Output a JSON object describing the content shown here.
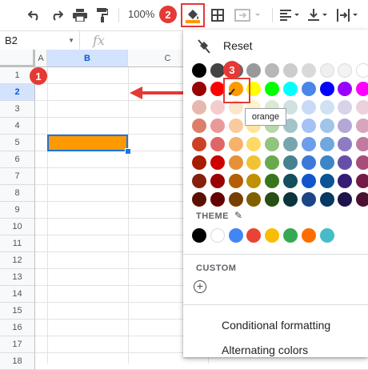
{
  "toolbar": {
    "zoom": "100%",
    "icons": [
      "undo-icon",
      "redo-icon",
      "print-icon",
      "paint-format-icon",
      "fill-color-icon",
      "borders-icon",
      "merge-cells-icon",
      "horizontal-align-icon",
      "vertical-align-icon",
      "text-rotation-icon"
    ]
  },
  "formula_bar": {
    "cell_ref": "B2",
    "fx": "fx"
  },
  "grid": {
    "columns": [
      "A",
      "B",
      "C"
    ],
    "rows": [
      "1",
      "2",
      "3",
      "4",
      "5",
      "6",
      "7",
      "8",
      "9",
      "10",
      "11",
      "12",
      "13",
      "14",
      "15",
      "16",
      "17",
      "18"
    ],
    "selected_cell": "B2",
    "fill_color": "#ff9900"
  },
  "callouts": {
    "step1": "1",
    "step2": "2",
    "step3": "3"
  },
  "color_menu": {
    "reset_label": "Reset",
    "tooltip": "orange",
    "theme_title": "THEME",
    "custom_title": "CUSTOM",
    "items": [
      {
        "label": "Conditional formatting"
      },
      {
        "label": "Alternating colors"
      }
    ],
    "standard_rows": [
      [
        "#000000",
        "#434343",
        "#666666",
        "#999999",
        "#b7b7b7",
        "#cccccc",
        "#d9d9d9",
        "#efefef",
        "#f3f3f3",
        "#ffffff"
      ],
      [
        "#980000",
        "#ff0000",
        "#ff9900",
        "#ffff00",
        "#00ff00",
        "#00ffff",
        "#4a86e8",
        "#0000ff",
        "#9900ff",
        "#ff00ff"
      ],
      [
        "#e6b8af",
        "#f4cccc",
        "#fce5cd",
        "#fff2cc",
        "#d9ead3",
        "#d0e0e3",
        "#c9daf8",
        "#cfe2f3",
        "#d9d2e9",
        "#ead1dc"
      ],
      [
        "#dd7e6b",
        "#ea9999",
        "#f9cb9c",
        "#ffe599",
        "#b6d7a8",
        "#a2c4c9",
        "#a4c2f4",
        "#9fc5e8",
        "#b4a7d6",
        "#d5a6bd"
      ],
      [
        "#cc4125",
        "#e06666",
        "#f6b26b",
        "#ffd966",
        "#93c47d",
        "#76a5af",
        "#6d9eeb",
        "#6fa8dc",
        "#8e7cc3",
        "#c27ba0"
      ],
      [
        "#a61c00",
        "#cc0000",
        "#e69138",
        "#f1c232",
        "#6aa84f",
        "#45818e",
        "#3c78d8",
        "#3d85c6",
        "#674ea7",
        "#a64d79"
      ],
      [
        "#85200c",
        "#990000",
        "#b45f06",
        "#bf9000",
        "#38761d",
        "#134f5c",
        "#1155cc",
        "#0b5394",
        "#351c75",
        "#741b47"
      ],
      [
        "#5b0f00",
        "#660000",
        "#783f04",
        "#7f6000",
        "#274e13",
        "#0c343d",
        "#1c4587",
        "#073763",
        "#20124d",
        "#4c1130"
      ]
    ],
    "theme_colors": [
      "#000000",
      "#ffffff",
      "#4285f4",
      "#ea4335",
      "#fbbc04",
      "#34a853",
      "#ff6d01",
      "#46bdc6"
    ],
    "selected_color": "#ff9900",
    "accent": "#e53935"
  }
}
